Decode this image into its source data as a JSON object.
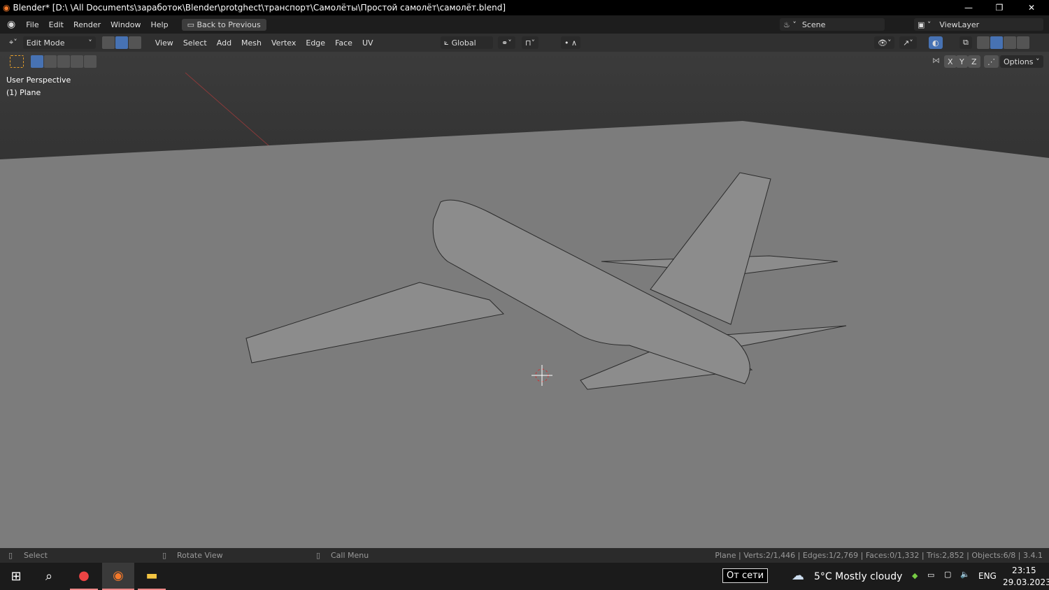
{
  "window": {
    "title": "Blender* [D:\\ \\All Documents\\заработок\\Blender\\protghect\\транспорт\\Самолёты\\Простой самолёт\\самолёт.blend]",
    "minimize": "—",
    "maximize": "❐",
    "close": "✕"
  },
  "menubar": {
    "items": [
      "File",
      "Edit",
      "Render",
      "Window",
      "Help"
    ],
    "back_button": "Back to Previous",
    "scene": "Scene",
    "view_layer": "ViewLayer"
  },
  "header": {
    "mode": "Edit Mode",
    "menus": [
      "View",
      "Select",
      "Add",
      "Mesh",
      "Vertex",
      "Edge",
      "Face",
      "UV"
    ],
    "orientation": "Global",
    "axes": [
      "X",
      "Y",
      "Z"
    ],
    "options": "Options",
    "accent": "#4772b3"
  },
  "viewport": {
    "view_name": "User Perspective",
    "object": "(1) Plane"
  },
  "statusbar": {
    "hints": [
      "Select",
      "Rotate View",
      "Call Menu"
    ],
    "stats": "Plane | Verts:2/1,446 | Edges:1/2,769 | Faces:0/1,332 | Tris:2,852 | Objects:6/8 | 3.4.1"
  },
  "taskbar": {
    "power": "От сети",
    "weather": "5°C  Mostly cloudy",
    "lang": "ENG",
    "time": "23:15",
    "date": "29.03.2023"
  }
}
